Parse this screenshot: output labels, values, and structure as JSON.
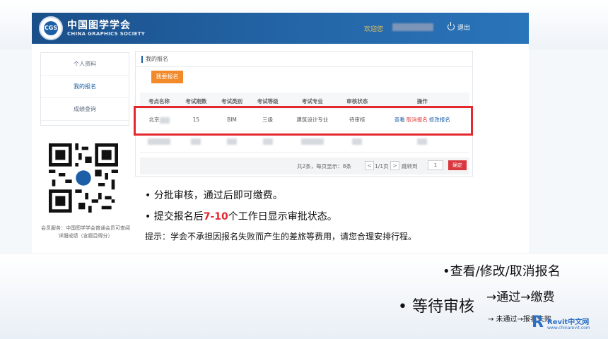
{
  "header": {
    "logo_text": "CGS",
    "brand_cn": "中国图学学会",
    "brand_en": "CHINA GRAPHICS SOCIETY",
    "welcome": "欢迎您",
    "logout": "退出"
  },
  "sidebar": {
    "items": [
      {
        "label": "个人资料"
      },
      {
        "label": "我的报名"
      },
      {
        "label": "成绩查询"
      }
    ],
    "qr_caption": "会员服务：中国图学学会普通会员可查阅详细成绩（含题目得分）"
  },
  "panel": {
    "title": "我的报名",
    "apply_button": "我要报名",
    "columns": [
      "考点名称",
      "考试期数",
      "考试类别",
      "考试等级",
      "考试专业",
      "审核状态",
      "操作"
    ],
    "row": {
      "site": "北京",
      "period": "15",
      "category": "BIM",
      "level": "三级",
      "major": "建筑设计专业",
      "status": "待审核",
      "op_view": "查看",
      "op_cancel": "取消报名",
      "op_edit": "修改报名"
    },
    "pager": {
      "info": "共2条，每页显示：8条",
      "prev": "<",
      "current": "1/1页",
      "next": ">",
      "goto_label": "跳转到",
      "goto_value": "1",
      "confirm": "确定"
    }
  },
  "bullets": {
    "b1": "• 分批审核，通过后即可缴费。",
    "b2_pre": "• 提交报名后",
    "b2_red": "7-10",
    "b2_post": "个工作日显示审批状态。",
    "tip": "提示：学会不承担因报名失败而产生的差旅等费用，请您合理安排行程。"
  },
  "annotations": {
    "ops": "•查看/修改/取消报名",
    "wait": "• 等待审核",
    "pass": "→通过→缴费",
    "fail": "→ 未通过→报名失败"
  },
  "watermark": {
    "letter": "R",
    "title": "Revit中文网",
    "url": "www.chinarevit.com"
  },
  "colors": {
    "header_blue": "#1d5fa6",
    "accent_orange": "#f28a2b",
    "highlight_red": "#e4282e"
  }
}
